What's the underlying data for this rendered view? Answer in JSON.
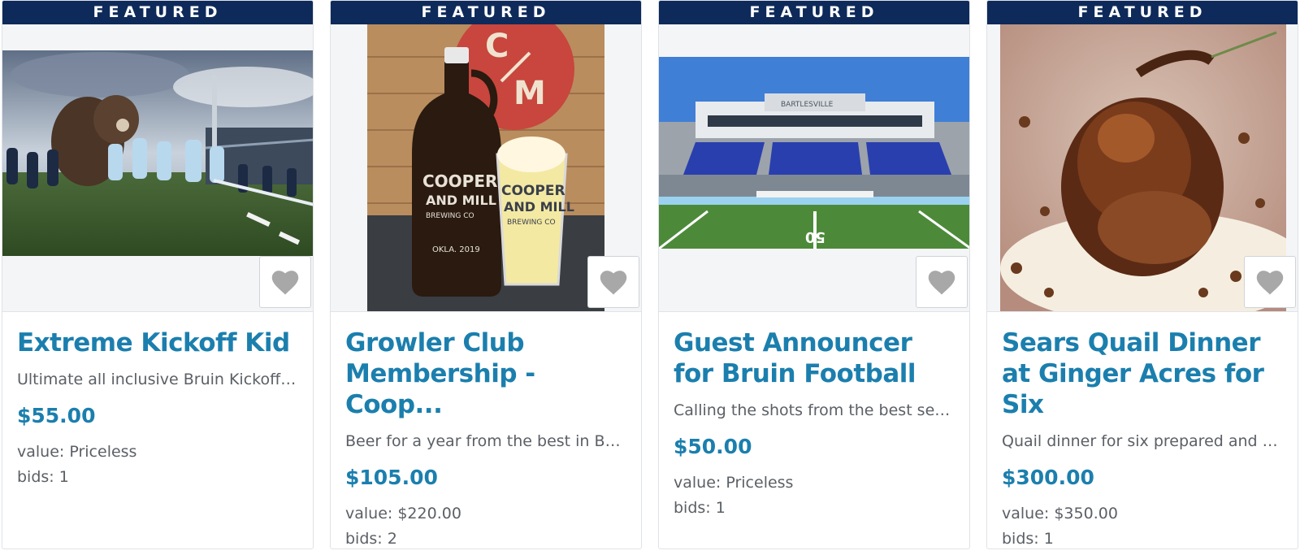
{
  "items": [
    {
      "badge": "FEATURED",
      "title": "Extreme Kickoff Kid",
      "description": "Ultimate all inclusive Bruin Kickoff Ki...",
      "price": "$55.00",
      "value": "value: Priceless",
      "bids": "bids: 1",
      "image_icon": "football-team-photo"
    },
    {
      "badge": "FEATURED",
      "title": "Growler Club Membership - Coop...",
      "description": "Beer for a year from the best in Bart...",
      "price": "$105.00",
      "value": "value: $220.00",
      "bids": "bids: 2",
      "image_icon": "beer-growler-photo",
      "photo_text": {
        "logo_top": "C",
        "logo_bottom": "M",
        "growler_brand_1": "COOPER",
        "growler_brand_2": "AND MILL",
        "growler_brand_3": "BREWING CO",
        "growler_year": "OKLA. 2019",
        "glass_brand_1": "COOPER",
        "glass_brand_2": "AND MILL",
        "glass_brand_3": "BREWING CO"
      }
    },
    {
      "badge": "FEATURED",
      "title": "Guest Announcer for Bruin Football",
      "description": "Calling the shots from the best seat i...",
      "price": "$50.00",
      "value": "value: Priceless",
      "bids": "bids: 1",
      "image_icon": "stadium-photo",
      "photo_text": {
        "stadium_sign": "BARTLESVILLE",
        "field_number": "50"
      }
    },
    {
      "badge": "FEATURED",
      "title": "Sears Quail Dinner at Ginger Acres for Six",
      "description": "Quail dinner for six prepared and h...",
      "price": "$300.00",
      "value": "value: $350.00",
      "bids": "bids: 1",
      "image_icon": "quail-dinner-photo"
    }
  ],
  "colors": {
    "banner": "#0e2a5a",
    "title": "#1b7fae",
    "text": "#5b6066",
    "heart": "#a8a8a8"
  },
  "favorite_icon": "heart-icon"
}
